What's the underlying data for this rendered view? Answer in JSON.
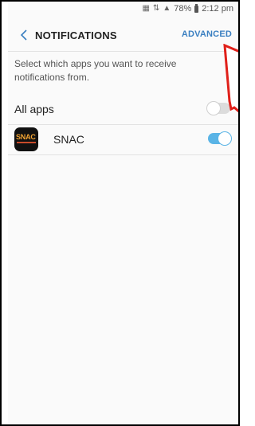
{
  "status_bar": {
    "battery": "78%",
    "time": "2:12 pm"
  },
  "header": {
    "title": "NOTIFICATIONS",
    "advanced_label": "ADVANCED"
  },
  "description": "Select which apps you want to receive notifications from.",
  "all_apps": {
    "label": "All apps",
    "enabled": false
  },
  "apps": [
    {
      "name": "SNAC",
      "icon_text": "SNAC",
      "enabled": true
    }
  ],
  "colors": {
    "accent": "#3a7fc1",
    "toggle_on": "#5ab4e6",
    "annotation": "#e0201a"
  }
}
